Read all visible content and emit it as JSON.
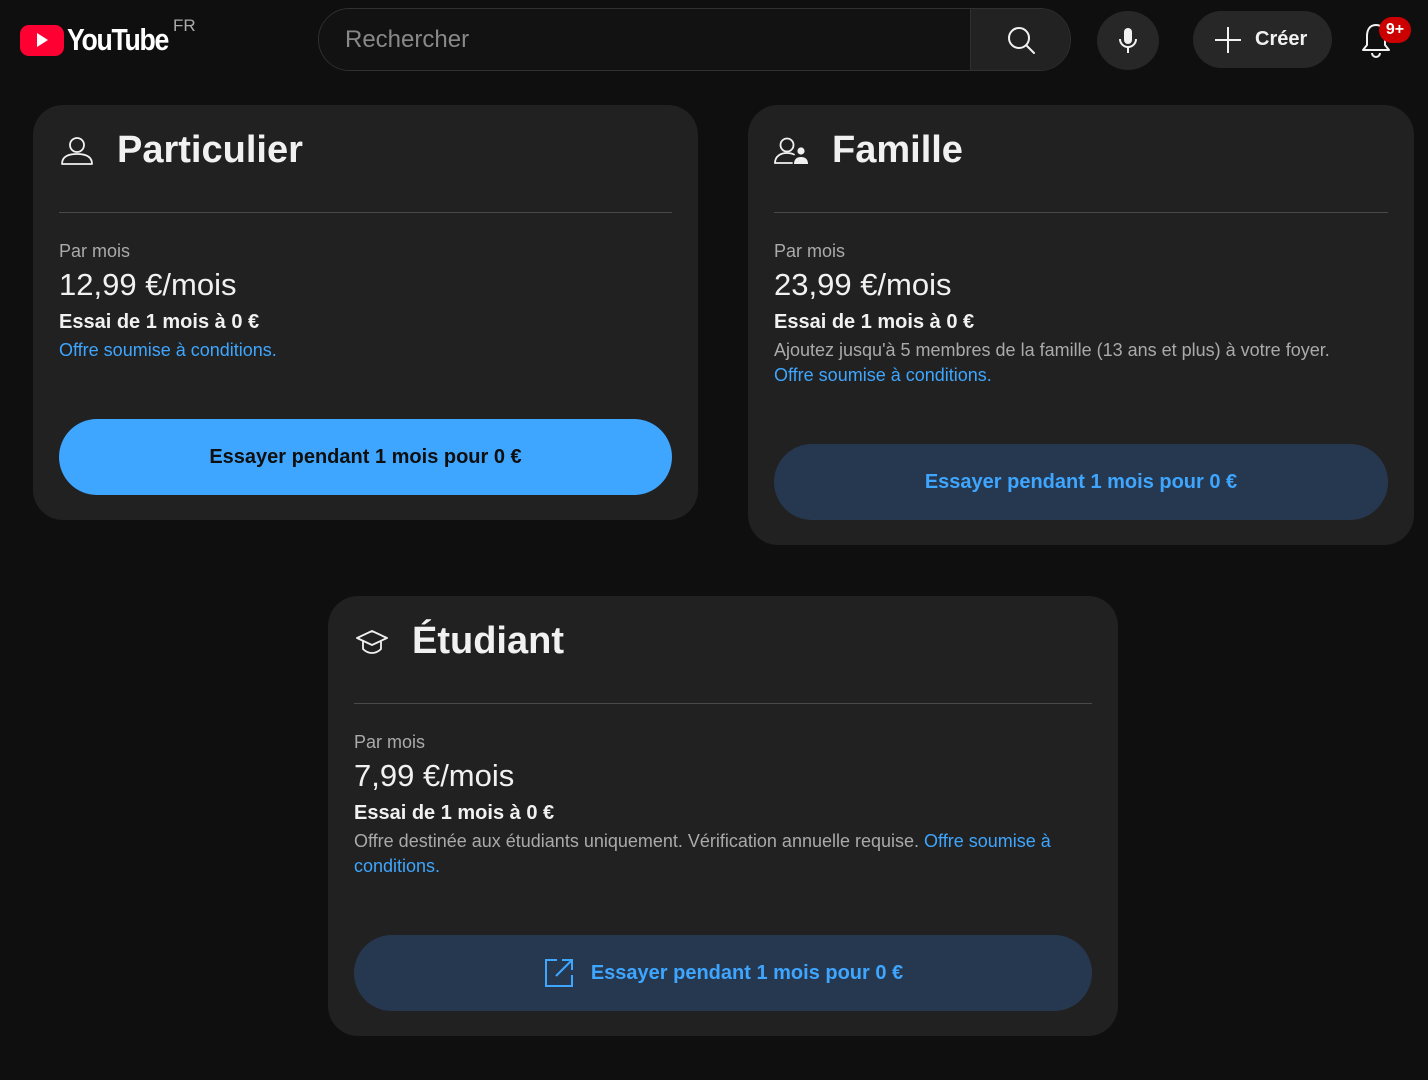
{
  "header": {
    "logo_text": "YouTube",
    "country_code": "FR",
    "search_placeholder": "Rechercher",
    "create_label": "Créer",
    "notifications_badge": "9+"
  },
  "plans": {
    "individual": {
      "title": "Particulier",
      "icon": "person-icon",
      "period_label": "Par mois",
      "price": "12,99 €/mois",
      "trial": "Essai de 1 mois à 0 €",
      "description": "",
      "conditions_link": "Offre soumise à conditions.",
      "cta": "Essayer pendant 1 mois pour 0 €"
    },
    "family": {
      "title": "Famille",
      "icon": "family-icon",
      "period_label": "Par mois",
      "price": "23,99 €/mois",
      "trial": "Essai de 1 mois à 0 €",
      "description": "Ajoutez jusqu'à 5 membres de la famille (13 ans et plus) à votre foyer.",
      "conditions_link": "Offre soumise à conditions.",
      "cta": "Essayer pendant 1 mois pour 0 €"
    },
    "student": {
      "title": "Étudiant",
      "icon": "graduation-cap-icon",
      "period_label": "Par mois",
      "price": "7,99 €/mois",
      "trial": "Essai de 1 mois à 0 €",
      "description": "Offre destinée aux étudiants uniquement. Vérification annuelle requise.",
      "conditions_link": "Offre soumise à conditions.",
      "cta": "Essayer pendant 1 mois pour 0 €"
    }
  },
  "colors": {
    "background": "#0f0f0f",
    "card": "#212121",
    "accent_blue": "#3ea6ff",
    "secondary_button": "#263850",
    "brand_red": "#ff0033"
  }
}
